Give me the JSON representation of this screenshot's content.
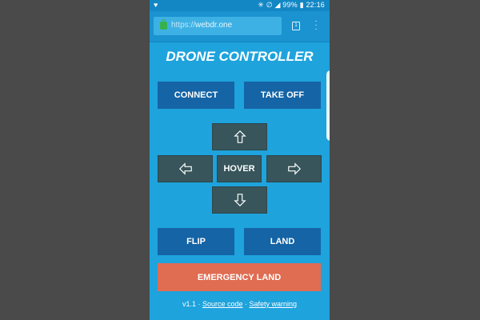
{
  "status_bar": {
    "left_icon": "heart-icon",
    "signal_text": "✳ ✶ ☈ ❙",
    "battery": "99%",
    "time": "22:16"
  },
  "browser": {
    "url_scheme": "https://",
    "url_host": "webdr.one",
    "tab_count": "1"
  },
  "app": {
    "title": "DRONE CONTROLLER",
    "connect_label": "CONNECT",
    "takeoff_label": "TAKE OFF",
    "hover_label": "HOVER",
    "flip_label": "FLIP",
    "land_label": "LAND",
    "emergency_label": "EMERGENCY LAND"
  },
  "footer": {
    "version": "v1.1",
    "sep1": " · ",
    "source_link": "Source code",
    "sep2": " · ",
    "safety_link": "Safety warning"
  },
  "colors": {
    "background": "#1ea3dd",
    "button_blue": "#1564a5",
    "button_dark": "#37555b",
    "emergency": "#e06c52"
  }
}
